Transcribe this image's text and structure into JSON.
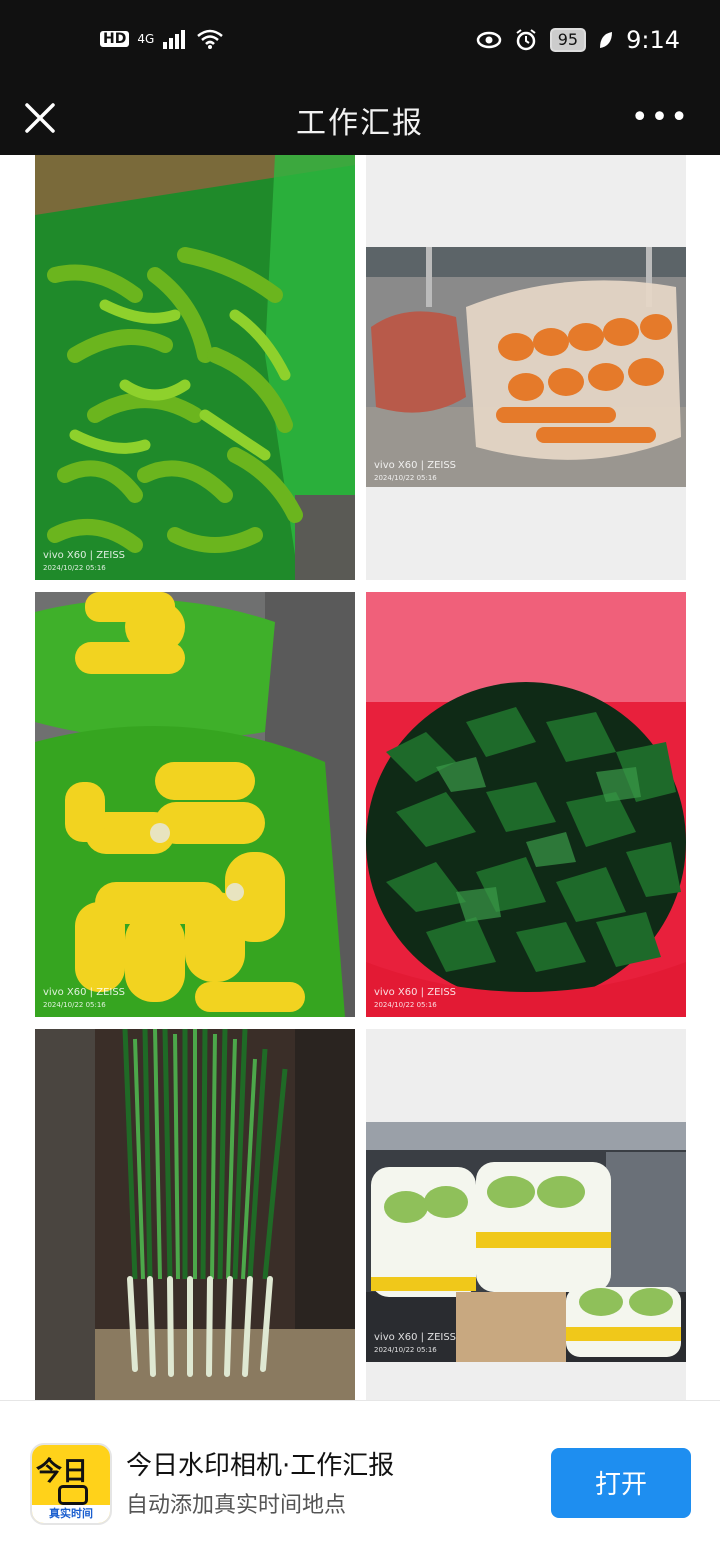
{
  "status_bar": {
    "network": "HD",
    "signal": "4G",
    "battery": "95",
    "time": "9:14"
  },
  "header": {
    "title": "工作汇报",
    "close_icon": "close-icon",
    "more_icon": "more-icon"
  },
  "photos": [
    {
      "subject": "green peppers",
      "watermark": "vivo X60 | ZEISS",
      "date": "2024/10/22 05:16"
    },
    {
      "subject": "carrots",
      "watermark": "vivo X60 | ZEISS",
      "date": "2024/10/22 05:16"
    },
    {
      "subject": "corn",
      "watermark": "vivo X60 | ZEISS",
      "date": "2024/10/22 05:16"
    },
    {
      "subject": "kelp",
      "watermark": "vivo X60 | ZEISS",
      "date": "2024/10/22 05:16"
    },
    {
      "subject": "green onions",
      "watermark": "",
      "date": ""
    },
    {
      "subject": "napa cabbage",
      "watermark": "vivo X60 | ZEISS",
      "date": "2024/10/22 05:16"
    }
  ],
  "app_banner": {
    "icon_text": "今日",
    "icon_strip": "真实时间",
    "app_name": "今日水印相机·工作汇报",
    "subtitle": "自动添加真实时间地点",
    "open_label": "打开"
  }
}
